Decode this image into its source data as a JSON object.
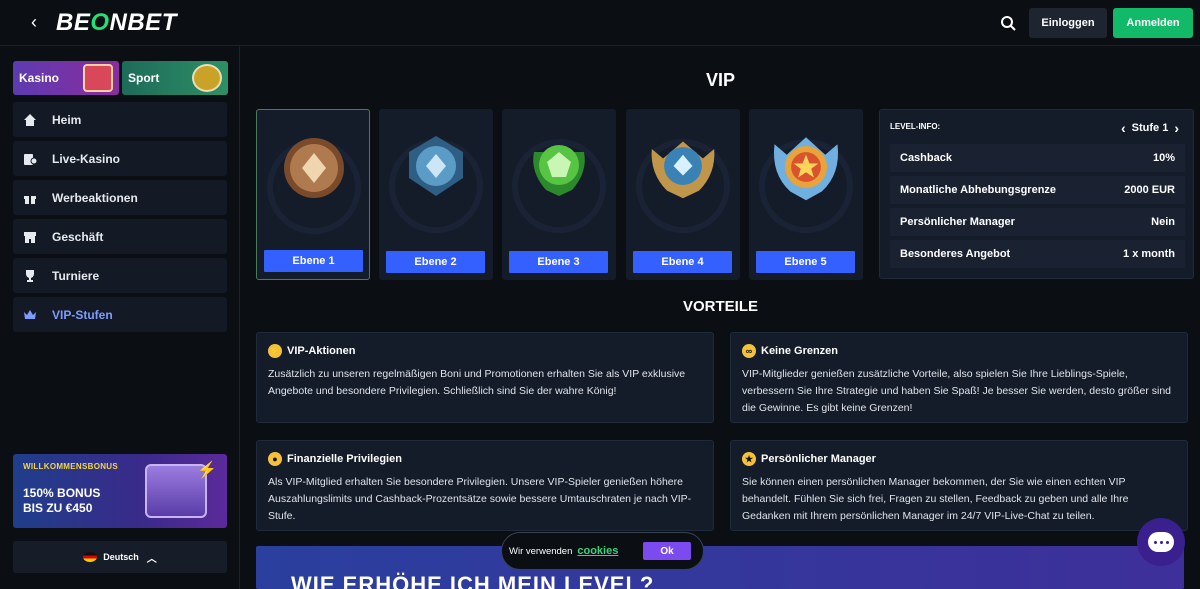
{
  "header": {
    "back_icon": "chevron-left-icon",
    "logo": "BEONBET",
    "login_label": "Einloggen",
    "register_label": "Anmelden"
  },
  "sidebar": {
    "categories": [
      {
        "label": "Kasino"
      },
      {
        "label": "Sport"
      }
    ],
    "items": [
      {
        "label": "Heim",
        "icon": "home-icon"
      },
      {
        "label": "Live-Kasino",
        "icon": "live-casino-icon"
      },
      {
        "label": "Werbeaktionen",
        "icon": "gift-icon"
      },
      {
        "label": "Geschäft",
        "icon": "shop-icon"
      },
      {
        "label": "Turniere",
        "icon": "trophy-icon"
      },
      {
        "label": "VIP-Stufen",
        "icon": "crown-icon"
      }
    ],
    "bonus": {
      "tag": "WILLKOMMENSBONUS",
      "line1": "150% BONUS",
      "line2": "BIS ZU €450"
    },
    "language": "Deutsch"
  },
  "main": {
    "title": "VIP",
    "levels": [
      {
        "label": "Ebene 1",
        "color": "#a86b3e"
      },
      {
        "label": "Ebene 2",
        "color": "#3f7aa8"
      },
      {
        "label": "Ebene 3",
        "color": "#3fae3a"
      },
      {
        "label": "Ebene 4",
        "color": "#3f8fc0"
      },
      {
        "label": "Ebene 5",
        "color": "#e6862a"
      }
    ],
    "level_info": {
      "head": "LEVEL-INFO:",
      "current": "Stufe 1",
      "rows": [
        {
          "k": "Cashback",
          "v": "10%"
        },
        {
          "k": "Monatliche Abhebungsgrenze",
          "v": "2000 EUR"
        },
        {
          "k": "Persönlicher Manager",
          "v": "Nein"
        },
        {
          "k": "Besonderes Angebot",
          "v": "1 x month"
        }
      ]
    },
    "benefits_title": "VORTEILE",
    "benefits": [
      {
        "title": "VIP-Aktionen",
        "icon": "lightning-icon",
        "text": "Zusätzlich zu unseren regelmäßigen Boni und Promotionen erhalten Sie als VIP exklusive Angebote und besondere Privilegien. Schließlich sind Sie der wahre König!"
      },
      {
        "title": "Keine Grenzen",
        "icon": "infinity-icon",
        "text": "VIP-Mitglieder genießen zusätzliche Vorteile, also spielen Sie Ihre Lieblings-Spiele, verbessern Sie Ihre Strategie und haben Sie Spaß! Je besser Sie werden, desto größer sind die Gewinne. Es gibt keine Grenzen!"
      },
      {
        "title": "Finanzielle Privilegien",
        "icon": "coins-icon",
        "text": "Als VIP-Mitglied erhalten Sie besondere Privilegien. Unsere VIP-Spieler genießen höhere Auszahlungslimits und Cashback-Prozentsätze sowie bessere Umtauschraten je nach VIP-Stufe."
      },
      {
        "title": "Persönlicher Manager",
        "icon": "star-icon",
        "text": "Sie können einen persönlichen Manager bekommen, der Sie wie einen echten VIP behandelt. Fühlen Sie sich frei, Fragen zu stellen, Feedback zu geben und alle Ihre Gedanken mit Ihrem persönlichen Manager im 24/7 VIP-Live-Chat zu teilen."
      }
    ],
    "banner_title": "WIE ERHÖHE ICH MEIN LEVEL?"
  },
  "cookie": {
    "text": "Wir verwenden",
    "link": "cookies",
    "ok": "Ok"
  }
}
